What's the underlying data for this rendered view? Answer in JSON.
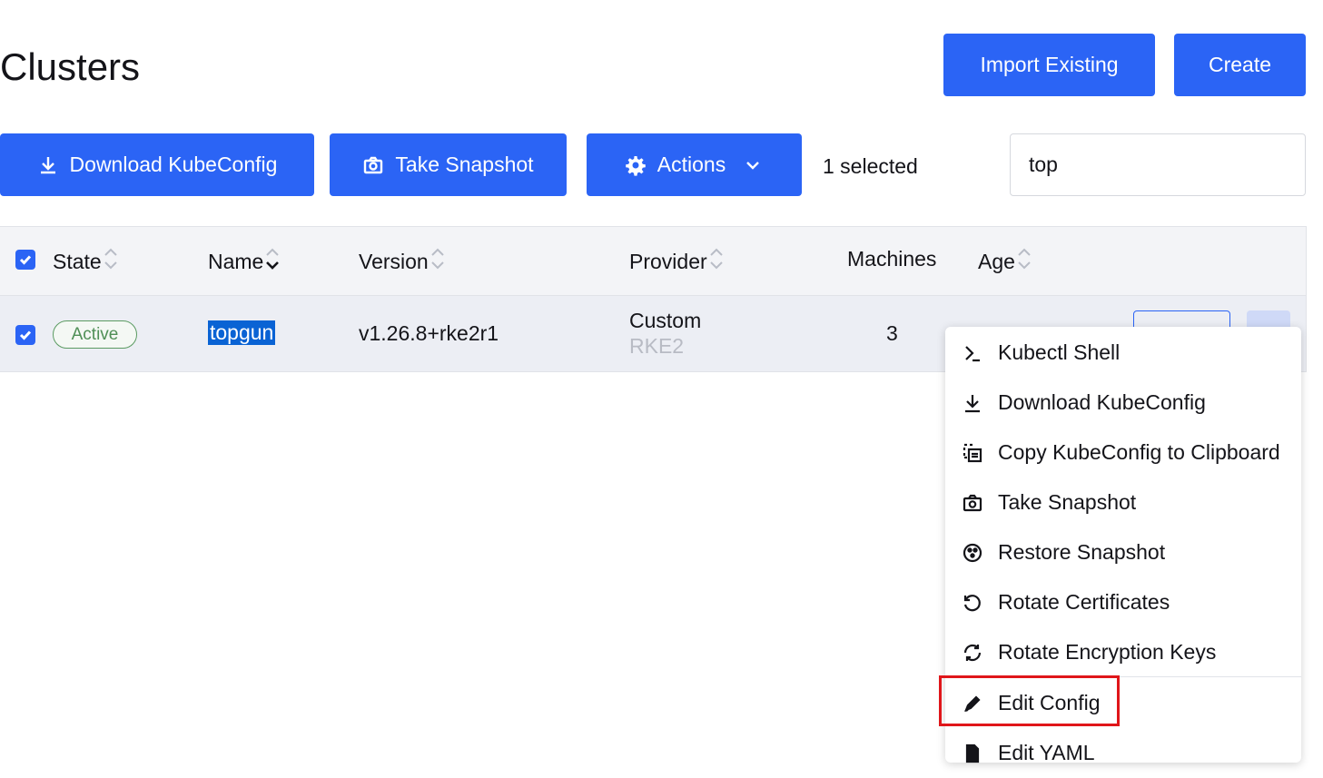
{
  "page": {
    "title": "Clusters"
  },
  "header_buttons": {
    "import": "Import Existing",
    "create": "Create"
  },
  "toolbar": {
    "download": "Download KubeConfig",
    "snapshot": "Take Snapshot",
    "actions": "Actions",
    "selected": "1 selected"
  },
  "search": {
    "value": "top"
  },
  "table": {
    "headers": {
      "state": "State",
      "name": "Name",
      "version": "Version",
      "provider": "Provider",
      "machines": "Machines",
      "age": "Age"
    },
    "row": {
      "state": "Active",
      "name": "topgun",
      "version": "v1.26.8+rke2r1",
      "provider": "Custom",
      "provider_sub": "RKE2",
      "machines": "3"
    }
  },
  "menu": {
    "items": [
      {
        "label": "Kubectl Shell",
        "icon": "terminal-icon"
      },
      {
        "label": "Download KubeConfig",
        "icon": "download-icon"
      },
      {
        "label": "Copy KubeConfig to Clipboard",
        "icon": "copy-icon"
      },
      {
        "label": "Take Snapshot",
        "icon": "camera-icon"
      },
      {
        "label": "Restore Snapshot",
        "icon": "restore-icon"
      },
      {
        "label": "Rotate Certificates",
        "icon": "rotate-icon"
      },
      {
        "label": "Rotate Encryption Keys",
        "icon": "refresh-icon"
      },
      {
        "label": "Edit Config",
        "icon": "pencil-icon"
      },
      {
        "label": "Edit YAML",
        "icon": "file-icon"
      }
    ]
  },
  "colors": {
    "primary": "#2b64f5",
    "highlight_box": "#e0161a",
    "active_badge": "#4f8f56"
  }
}
